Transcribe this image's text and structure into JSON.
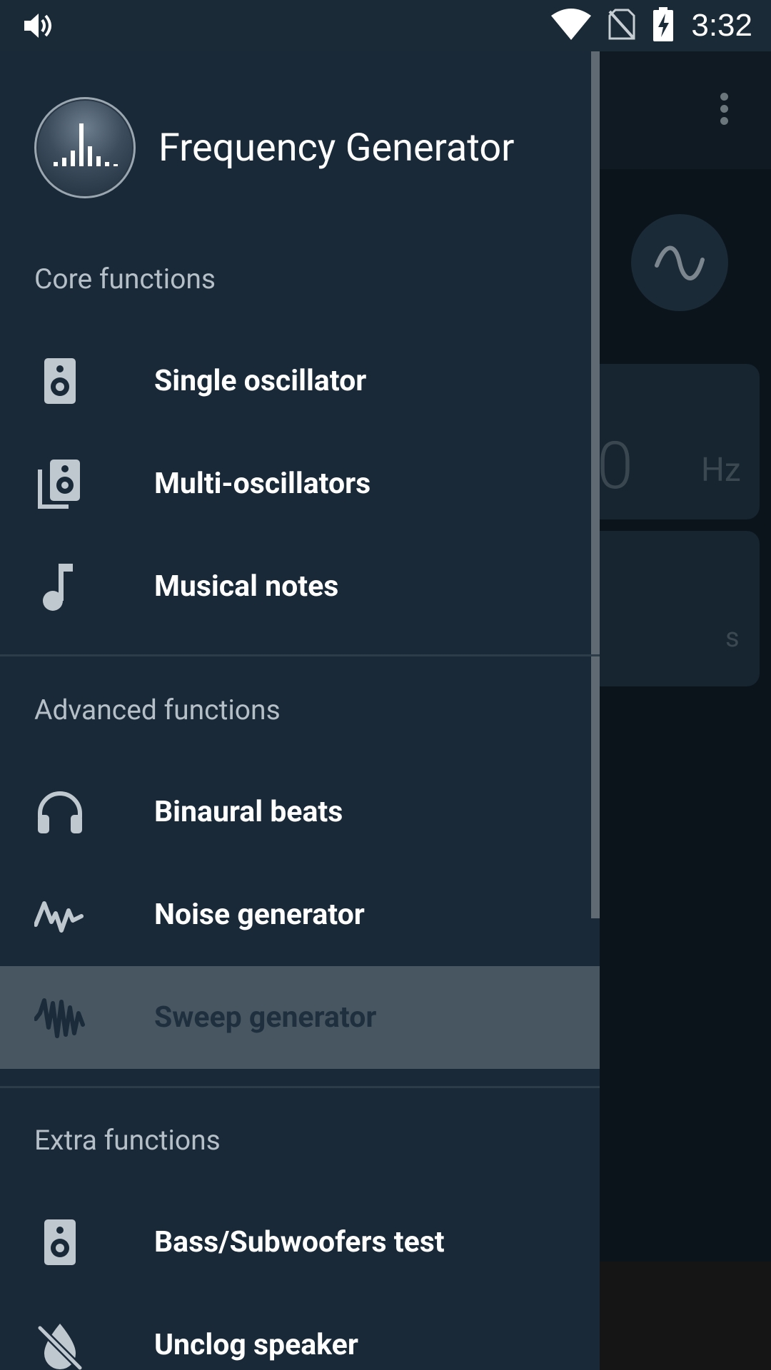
{
  "status_bar": {
    "time": "3:32"
  },
  "drawer": {
    "app_title": "Frequency Generator",
    "sections": [
      {
        "label": "Core functions",
        "items": [
          {
            "label": "Single oscillator",
            "icon": "speaker-icon"
          },
          {
            "label": "Multi-oscillators",
            "icon": "multi-speaker-icon"
          },
          {
            "label": "Musical notes",
            "icon": "music-note-icon"
          }
        ]
      },
      {
        "label": "Advanced functions",
        "items": [
          {
            "label": "Binaural beats",
            "icon": "headphones-icon"
          },
          {
            "label": "Noise generator",
            "icon": "noise-wave-icon"
          },
          {
            "label": "Sweep generator",
            "icon": "sweep-wave-icon",
            "selected": true
          }
        ]
      },
      {
        "label": "Extra functions",
        "items": [
          {
            "label": "Bass/Subwoofers test",
            "icon": "speaker-icon"
          },
          {
            "label": "Unclog speaker",
            "icon": "unclog-speaker-icon"
          }
        ]
      }
    ]
  },
  "background_app": {
    "frequency_value_fragment": "0",
    "frequency_unit": "Hz",
    "duration_unit": "s"
  },
  "colors": {
    "drawer_bg": "#192938",
    "status_bar_bg": "#1a2a37",
    "selected_item_bg": "#475661",
    "section_label": "#b5bfc7",
    "icon_gray": "#bfc8cf"
  }
}
